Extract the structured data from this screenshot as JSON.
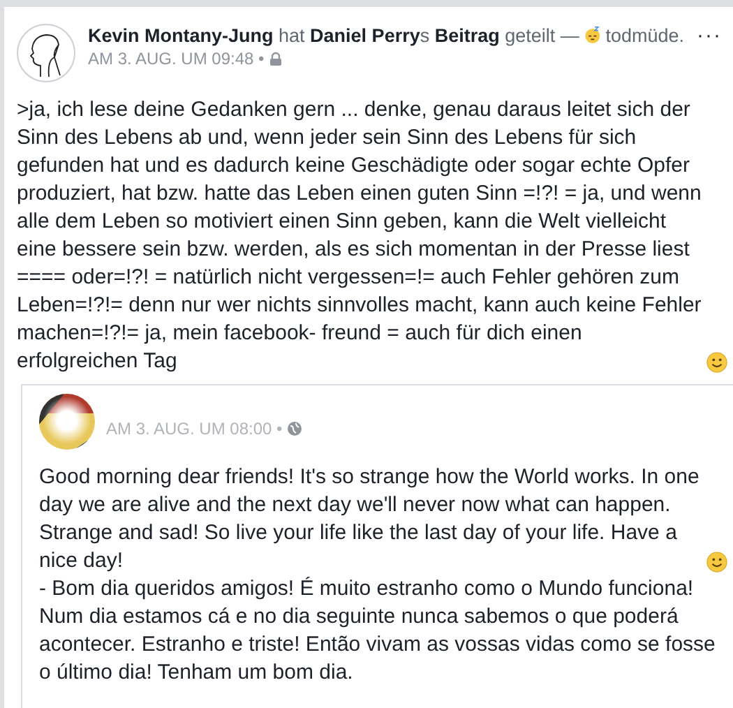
{
  "post": {
    "header": "**Kevin Montany-Jung** hat **Daniel Perry**s **Beitrag** geteilt —",
    "feeling": "todmüde.",
    "more": "···",
    "time": "AM 3. AUG. UM 09:48 •",
    "text": ">ja, ich lese deine Gedanken gern ... denke, genau daraus leitet sich der Sinn des Lebens ab und, wenn  jeder sein Sinn des Lebens für sich gefunden hat und es dadurch keine Geschädigte oder sogar echte Opfer produziert, hat bzw. hatte das Leben einen guten  Sinn =!?! = ja, und wenn alle dem Leben so motiviert einen Sinn geben, kann die Welt vielleicht eine bessere sein bzw. werden, als es sich momentan in der Presse liest  ==== oder=!?! = natürlich nicht vergessen=!= auch Fehler gehören zum Leben=!?!= denn nur wer nichts sinnvolles  macht, kann auch keine Fehler machen=!?!= ja, mein facebook- freund = auch für dich einen erfolgreichen Tag"
  },
  "shared": {
    "time": "AM 3. AUG. UM 08:00 •",
    "paragraphs": [
      "Good morning dear friends! It's so strange how the World works. In one day we are alive and the next day we'll never now what can happen. Strange and sad! So live your life like the last day of your life. Have a nice day!",
      "- Bom dia queridos amigos! É muito estranho como o Mundo funciona! Num dia estamos cá e no dia seguinte nunca sabemos o que poderá acontecer. Estranho e triste! Então vivam as vossas vidas como se fosse o último dia! Tenham um bom dia."
    ]
  }
}
